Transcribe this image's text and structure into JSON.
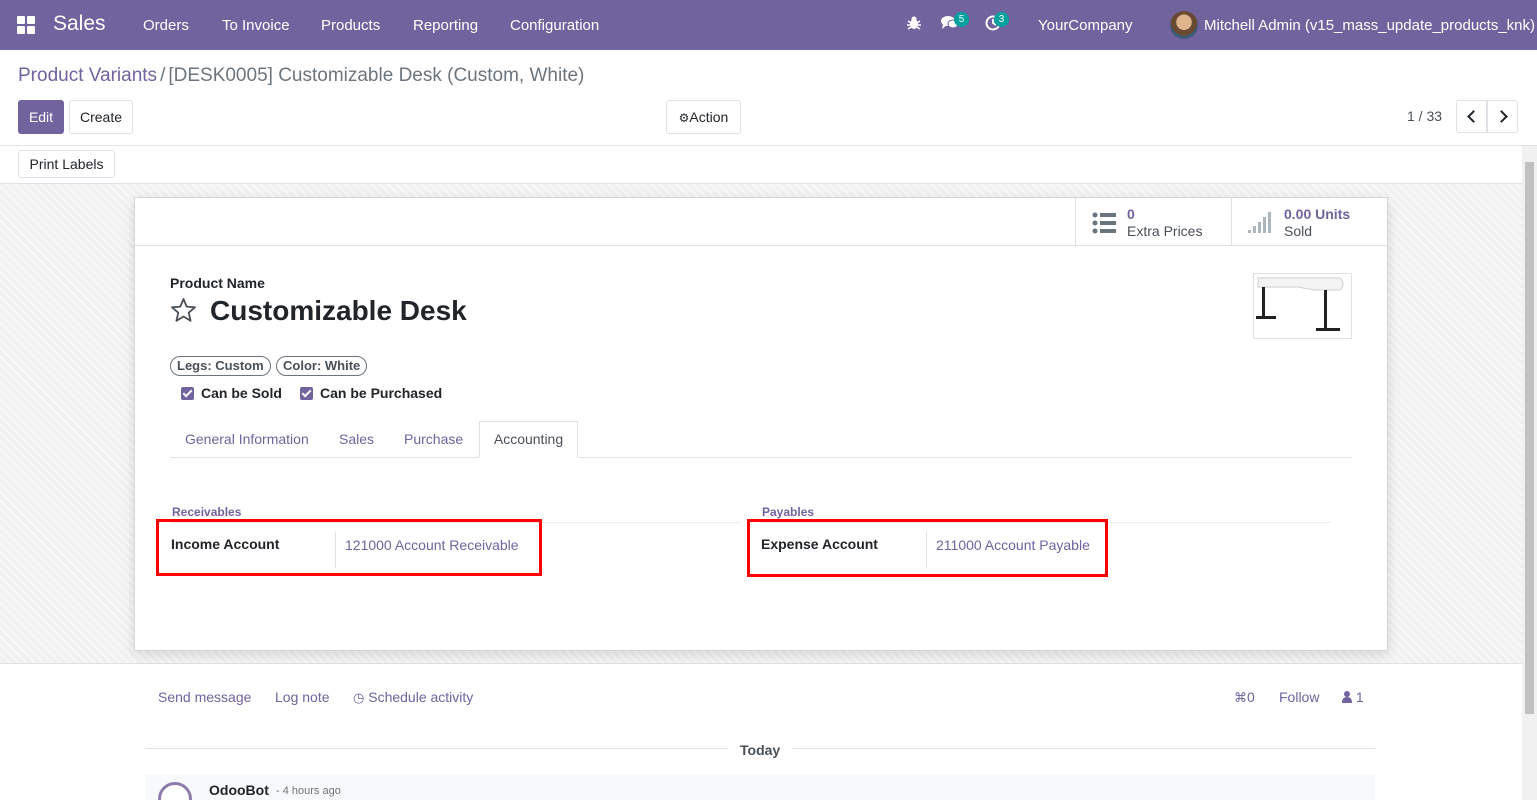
{
  "navbar": {
    "app_name": "Sales",
    "menu": [
      "Orders",
      "To Invoice",
      "Products",
      "Reporting",
      "Configuration"
    ],
    "messages_count": "5",
    "activities_count": "3",
    "company": "YourCompany",
    "user": "Mitchell Admin (v15_mass_update_products_knk)"
  },
  "control_panel": {
    "breadcrumb_parent": "Product Variants",
    "breadcrumb_separator": "/",
    "breadcrumb_current": "[DESK0005] Customizable Desk (Custom, White)",
    "edit_label": "Edit",
    "create_label": "Create",
    "action_label": "Action",
    "pager_value": "1 / 33",
    "print_labels": "Print Labels"
  },
  "stat_buttons": {
    "extra_prices_value": "0",
    "extra_prices_label": "Extra Prices",
    "sold_value": "0.00 Units",
    "sold_label": "Sold"
  },
  "product": {
    "name_label": "Product Name",
    "name": "Customizable Desk",
    "tags": [
      "Legs: Custom",
      "Color: White"
    ],
    "can_be_sold": "Can be Sold",
    "can_be_purchased": "Can be Purchased"
  },
  "tabs": [
    "General Information",
    "Sales",
    "Purchase",
    "Accounting"
  ],
  "active_tab": "Accounting",
  "accounting": {
    "receivables_title": "Receivables",
    "income_account_label": "Income Account",
    "income_account_value": "121000 Account Receivable",
    "payables_title": "Payables",
    "expense_account_label": "Expense Account",
    "expense_account_value": "211000 Account Payable"
  },
  "chatter": {
    "send_message": "Send message",
    "log_note": "Log note",
    "schedule_activity": "Schedule activity",
    "attachments_count": "0",
    "follow": "Follow",
    "followers_count": "1",
    "date_separator": "Today",
    "message_author": "OdooBot",
    "message_time": "- 4 hours ago"
  },
  "colors": {
    "brand": "#71639e",
    "badge": "#00a09d",
    "highlight": "#ff0000"
  }
}
